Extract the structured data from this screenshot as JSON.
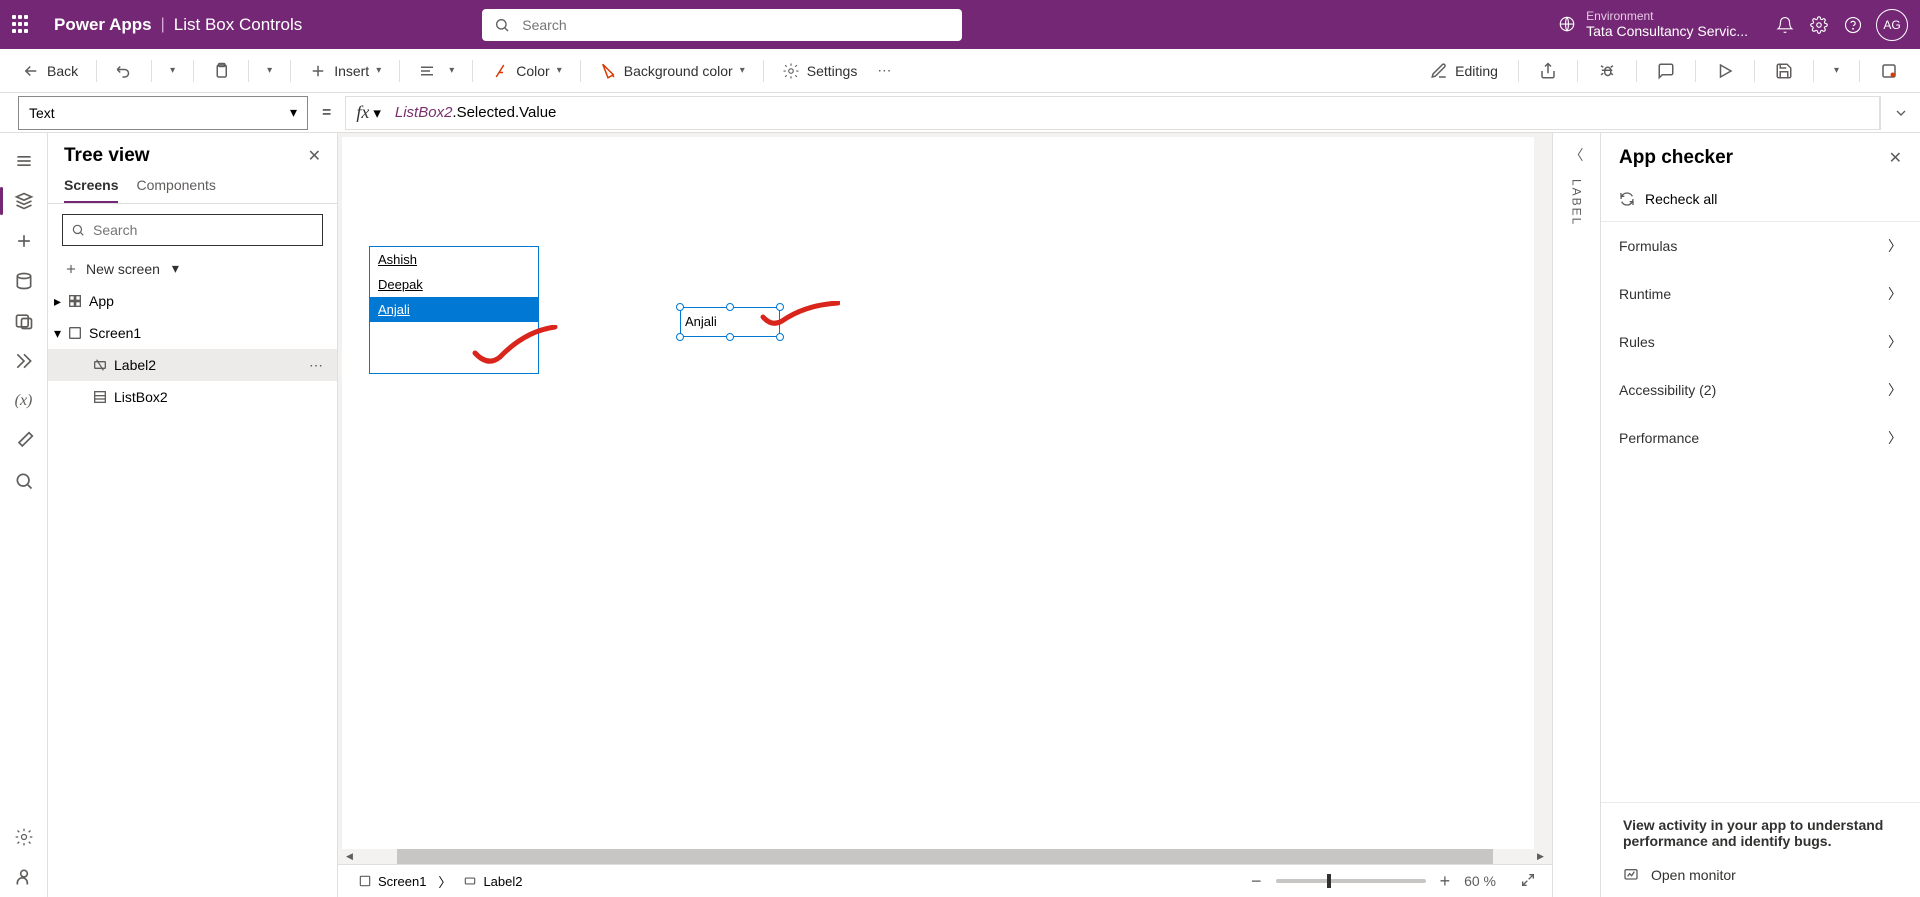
{
  "header": {
    "brand": "Power Apps",
    "file": "List Box Controls",
    "search_placeholder": "Search",
    "env_label": "Environment",
    "env_value": "Tata Consultancy Servic...",
    "avatar": "AG"
  },
  "cmd": {
    "back": "Back",
    "insert": "Insert",
    "color": "Color",
    "bg": "Background color",
    "settings": "Settings",
    "editing": "Editing"
  },
  "formula": {
    "property": "Text",
    "expr_obj": "ListBox2",
    "expr_rest": ".Selected.Value"
  },
  "tree": {
    "title": "Tree view",
    "tab_screens": "Screens",
    "tab_components": "Components",
    "search_placeholder": "Search",
    "new_screen": "New screen",
    "app": "App",
    "screen1": "Screen1",
    "label2": "Label2",
    "listbox2": "ListBox2"
  },
  "canvas": {
    "listbox_items": [
      "Ashish",
      "Deepak",
      "Anjali"
    ],
    "selected_index": 2,
    "label_value": "Anjali"
  },
  "breadcrumb": {
    "screen": "Screen1",
    "control": "Label2",
    "zoom": "60",
    "zoom_unit": "%"
  },
  "proptab": {
    "label": "LABEL"
  },
  "checker": {
    "title": "App checker",
    "recheck": "Recheck all",
    "cats": {
      "formulas": "Formulas",
      "runtime": "Runtime",
      "rules": "Rules",
      "accessibility": "Accessibility (2)",
      "performance": "Performance"
    },
    "activity_text": "View activity in your app to understand performance and identify bugs.",
    "open_monitor": "Open monitor"
  }
}
